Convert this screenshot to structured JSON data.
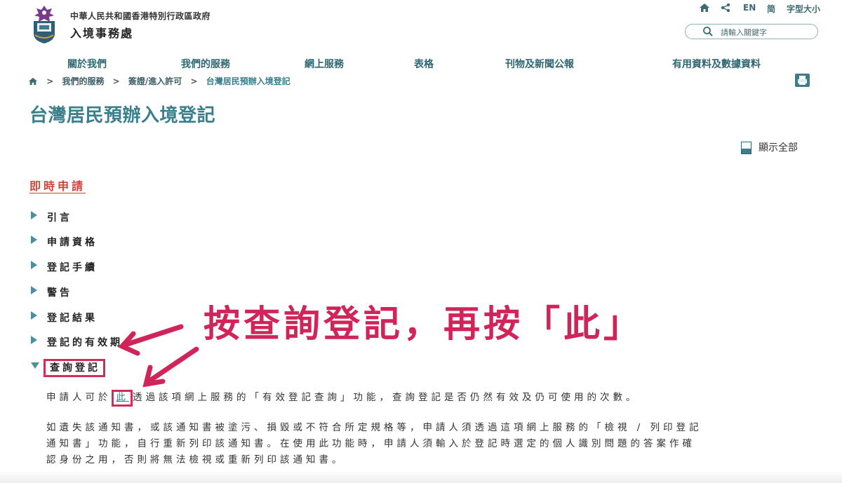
{
  "header": {
    "gov_name": "中華人民共和國香港特別行政區政府",
    "dept_name": "入境事務處",
    "tools": {
      "lang_en": "EN",
      "lang_sc": "简",
      "font_size": "字型大小"
    },
    "search": {
      "placeholder": "請輸入關鍵字"
    }
  },
  "nav": [
    "關於我們",
    "我們的服務",
    "網上服務",
    "表格",
    "刊物及新聞公報",
    "有用資料及數據資料"
  ],
  "breadcrumb": [
    "我們的服務",
    "簽證/進入許可",
    "台灣居民預辦入境登記"
  ],
  "page": {
    "title": "台灣居民預辦入境登記",
    "show_all": "顯示全部",
    "instant_apply": "即時申請"
  },
  "accordion": [
    {
      "label": "引言",
      "expanded": false
    },
    {
      "label": "申請資格",
      "expanded": false
    },
    {
      "label": "登記手續",
      "expanded": false
    },
    {
      "label": "警告",
      "expanded": false
    },
    {
      "label": "登記結果",
      "expanded": false
    },
    {
      "label": "登記的有效期",
      "expanded": false
    },
    {
      "label": "查詢登記",
      "expanded": true
    }
  ],
  "content": {
    "p1_before": "申請人可於",
    "p1_link": "此",
    "p1_after": "透過該項網上服務的「有效登記查詢」功能，查詢登記是否仍然有效及仍可使用的次數。",
    "p2_line1": "如遺失該通知書，或該通知書被塗污、損毀或不符合所定規格等，申請人須透過這項網上服務的「檢視 / 列印登記",
    "p2_line2": "通知書」功能，自行重新列印該通知書。在使用此功能時，申請人須輸入於登記時選定的個人識別問題的答案作確",
    "p2_line3": "認身份之用，否則將無法檢視或重新列印該通知書。"
  },
  "annotation": {
    "text": "按查詢登記，再按「此」",
    "color": "#d0245a"
  },
  "colors": {
    "accent": "#3a7f8b",
    "nav": "#2e6772",
    "instant": "#d0453b",
    "annotation": "#d22c5a"
  },
  "icons": [
    "home-icon",
    "share-icon",
    "search-icon",
    "print-icon",
    "logo-emblem"
  ]
}
